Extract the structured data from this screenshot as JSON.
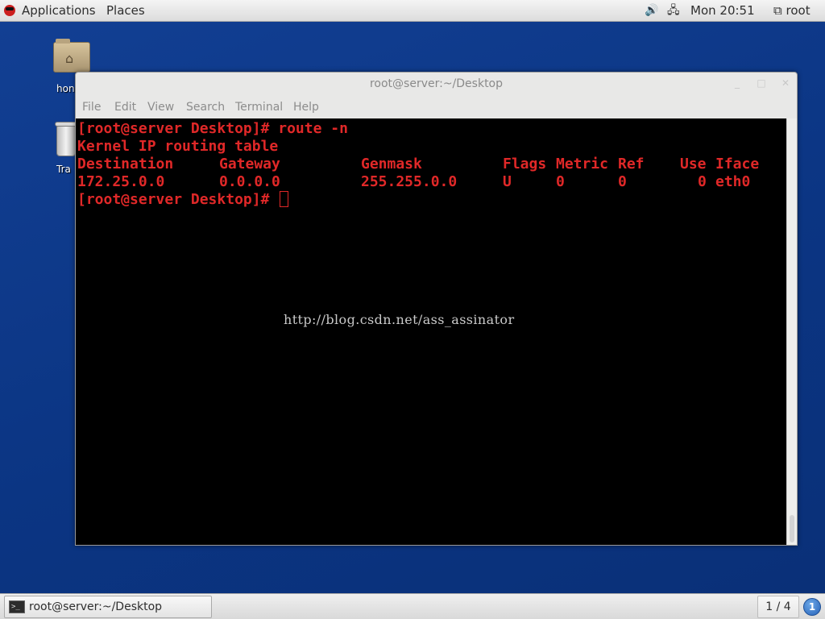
{
  "topbar": {
    "applications": "Applications",
    "places": "Places",
    "volume_icon": "speaker-icon",
    "network_icon": "network-icon",
    "clock": "Mon 20:51",
    "user_icon": "user-icon",
    "user": "root"
  },
  "desktop": {
    "home_label": "hon",
    "trash_label": "Tra"
  },
  "window": {
    "title": "root@server:~/Desktop",
    "menu": {
      "file": "File",
      "edit": "Edit",
      "view": "View",
      "search": "Search",
      "terminal": "Terminal",
      "help": "Help"
    }
  },
  "terminal": {
    "line1": "[root@server Desktop]# route -n",
    "line2": "Kernel IP routing table",
    "headers": [
      "Destination",
      "Gateway",
      "Genmask",
      "Flags",
      "Metric",
      "Ref",
      "Use",
      "Iface"
    ],
    "row": [
      "172.25.0.0",
      "0.0.0.0",
      "255.255.0.0",
      "U",
      "0",
      "0",
      "0",
      "eth0"
    ],
    "prompt": "[root@server Desktop]# "
  },
  "watermark": "http://blog.csdn.net/ass_assinator",
  "taskbar": {
    "task_label": "root@server:~/Desktop",
    "workspace": "1 / 4",
    "notifications": "1"
  },
  "colors": {
    "desktop": "#0d3a8a",
    "terminal_bg": "#000000",
    "terminal_text": "#e02828"
  }
}
